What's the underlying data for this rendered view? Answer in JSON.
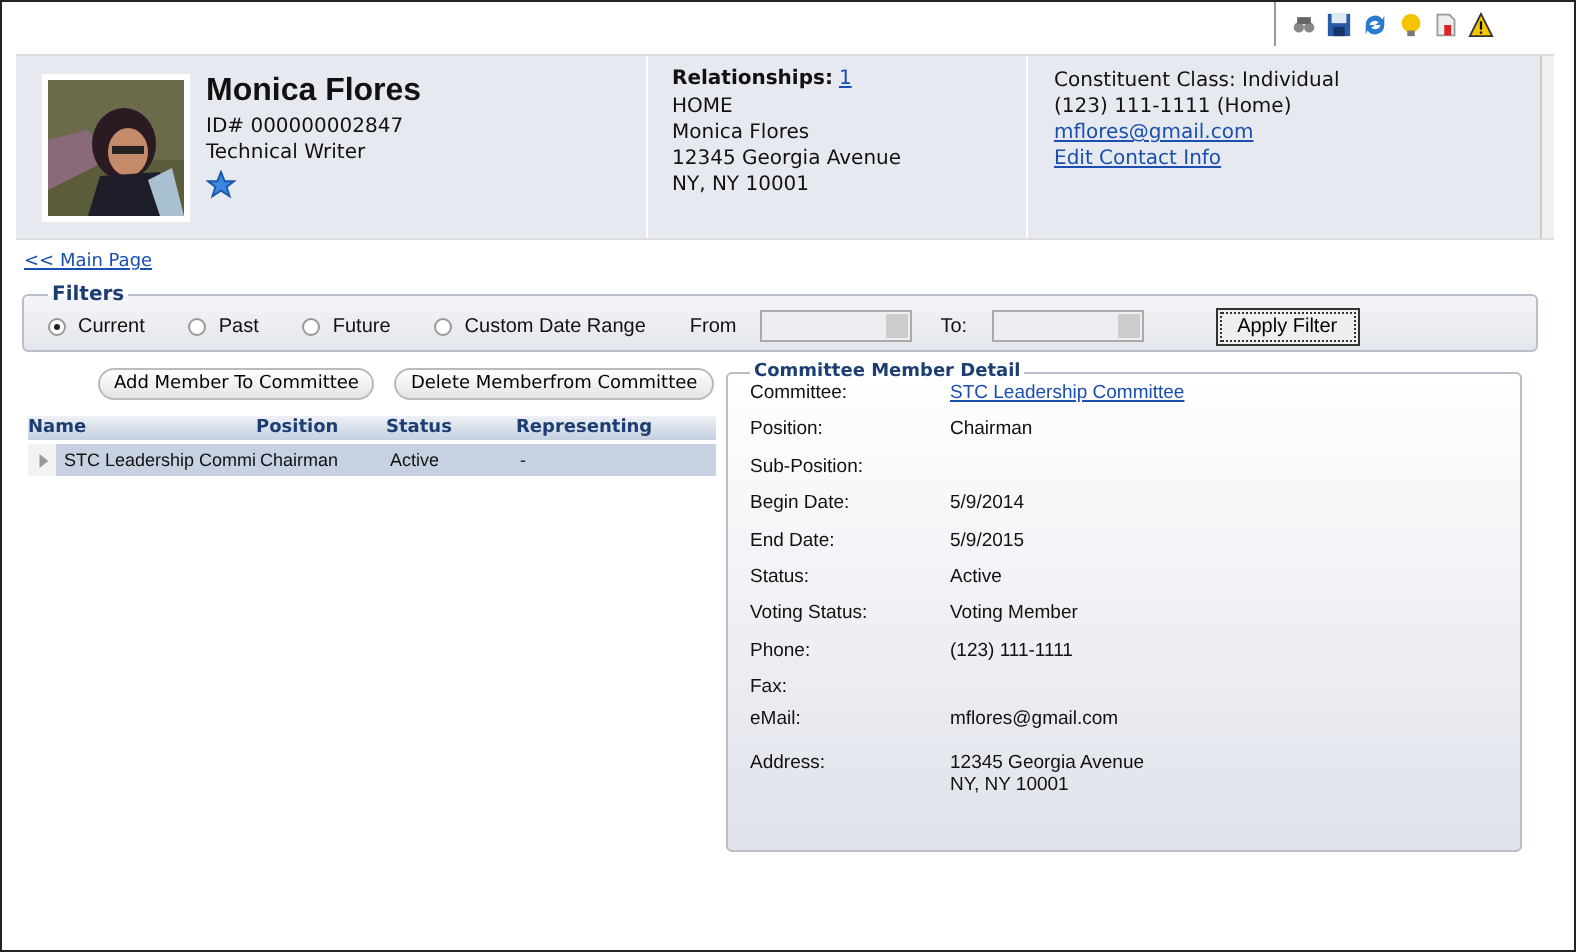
{
  "toolbar": {
    "icons": [
      {
        "kind": "binoculars"
      },
      {
        "kind": "save"
      },
      {
        "kind": "refresh"
      },
      {
        "kind": "bulb"
      },
      {
        "kind": "report"
      },
      {
        "kind": "warning"
      }
    ]
  },
  "profile": {
    "name": "Monica Flores",
    "id": "ID# 000000002847",
    "title": "Technical Writer",
    "favorite": true,
    "relationships_label": "Relationships:",
    "relationships_count": "1",
    "address_lines": [
      "HOME",
      "Monica Flores",
      "12345 Georgia Avenue",
      "NY, NY 10001"
    ],
    "contact": [
      {
        "kind": "text",
        "text": "Constituent Class: Individual"
      },
      {
        "kind": "text",
        "text": "(123) 111-1111 (Home)"
      },
      {
        "kind": "link",
        "text": "mflores@gmail.com"
      },
      {
        "kind": "link",
        "text": "Edit Contact Info"
      }
    ]
  },
  "main_page_link": "<< Main Page",
  "filters": {
    "legend": "Filters",
    "options": [
      {
        "label": "Current",
        "selected": true
      },
      {
        "label": "Past",
        "selected": false
      },
      {
        "label": "Future",
        "selected": false
      },
      {
        "label": "Custom Date Range",
        "selected": false
      }
    ],
    "from_label": "From",
    "to_label": "To:",
    "dates_disabled": true,
    "apply": "Apply Filter"
  },
  "buttons": [
    "Add Member To Committee",
    "Delete Memberfrom Committee"
  ],
  "table": {
    "columns": [
      "Name",
      "Position",
      "Status",
      "Representing"
    ],
    "rows": [
      {
        "cells": [
          "STC Leadership Commi",
          "Chairman",
          "Active",
          "-"
        ],
        "selected": true,
        "expanded": false
      }
    ]
  },
  "detail": {
    "legend": "Committee Member Detail",
    "fields": [
      {
        "label": "Committee:",
        "kind": "link",
        "lines": [
          "STC Leadership Committee"
        ]
      },
      {
        "label": "Position:",
        "kind": "text",
        "lines": [
          "Chairman"
        ]
      },
      {
        "label": "Sub-Position:",
        "kind": "text"
      },
      {
        "label": "Begin Date:",
        "kind": "text",
        "lines": [
          "5/9/2014"
        ]
      },
      {
        "label": "End Date:",
        "kind": "text",
        "lines": [
          "5/9/2015"
        ]
      },
      {
        "label": "Status:",
        "kind": "text",
        "lines": [
          "Active"
        ]
      },
      {
        "label": "Voting Status:",
        "kind": "text",
        "lines": [
          "Voting Member"
        ]
      },
      {
        "label": "Phone:",
        "kind": "text",
        "lines": [
          "(123) 111-1111"
        ]
      },
      {
        "label": "Fax:",
        "kind": "short"
      },
      {
        "label": "eMail:",
        "kind": "text",
        "lines": [
          "mflores@gmail.com"
        ]
      },
      {
        "label": "Address:",
        "kind": "text",
        "lines": [
          "12345 Georgia Avenue",
          "NY, NY 10001"
        ]
      }
    ]
  }
}
